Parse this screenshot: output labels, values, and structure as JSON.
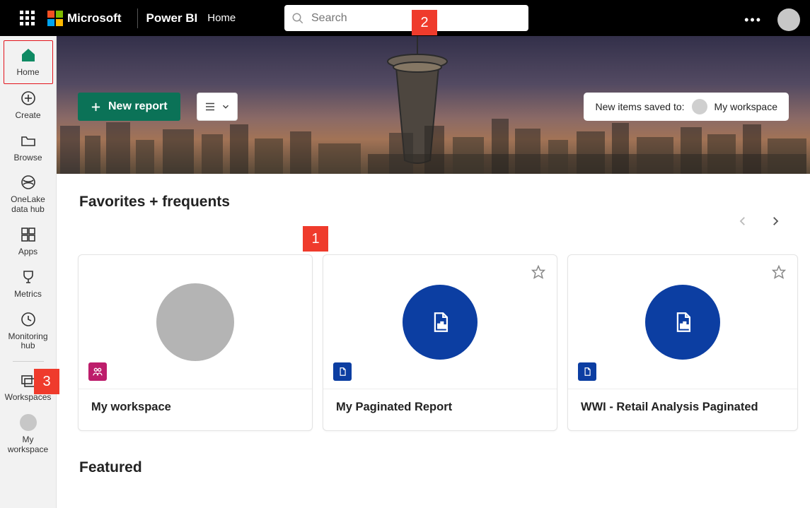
{
  "header": {
    "brand": "Microsoft",
    "product": "Power BI",
    "crumb": "Home",
    "search_placeholder": "Search"
  },
  "logo_colors": [
    "#f25022",
    "#7fba00",
    "#00a4ef",
    "#ffb900"
  ],
  "nav": {
    "items": [
      {
        "id": "home",
        "label": "Home",
        "selected": true
      },
      {
        "id": "create",
        "label": "Create"
      },
      {
        "id": "browse",
        "label": "Browse"
      },
      {
        "id": "onelake",
        "label": "OneLake data hub"
      },
      {
        "id": "apps",
        "label": "Apps"
      },
      {
        "id": "metrics",
        "label": "Metrics"
      },
      {
        "id": "monitoring",
        "label": "Monitoring hub"
      },
      {
        "id": "workspaces",
        "label": "Workspaces"
      },
      {
        "id": "myworkspace",
        "label": "My workspace"
      }
    ]
  },
  "banner": {
    "new_report_label": "New report",
    "saved_to_label": "New items saved to:",
    "saved_to_target": "My workspace"
  },
  "sections": {
    "favorites_title": "Favorites + frequents",
    "featured_title": "Featured"
  },
  "cards": [
    {
      "title": "My workspace",
      "type": "workspace",
      "favoritable": false
    },
    {
      "title": "My Paginated Report",
      "type": "paginated",
      "favoritable": true
    },
    {
      "title": "WWI - Retail Analysis Paginated",
      "type": "paginated",
      "favoritable": true
    }
  ],
  "callouts": {
    "1": "1",
    "2": "2",
    "3": "3"
  }
}
